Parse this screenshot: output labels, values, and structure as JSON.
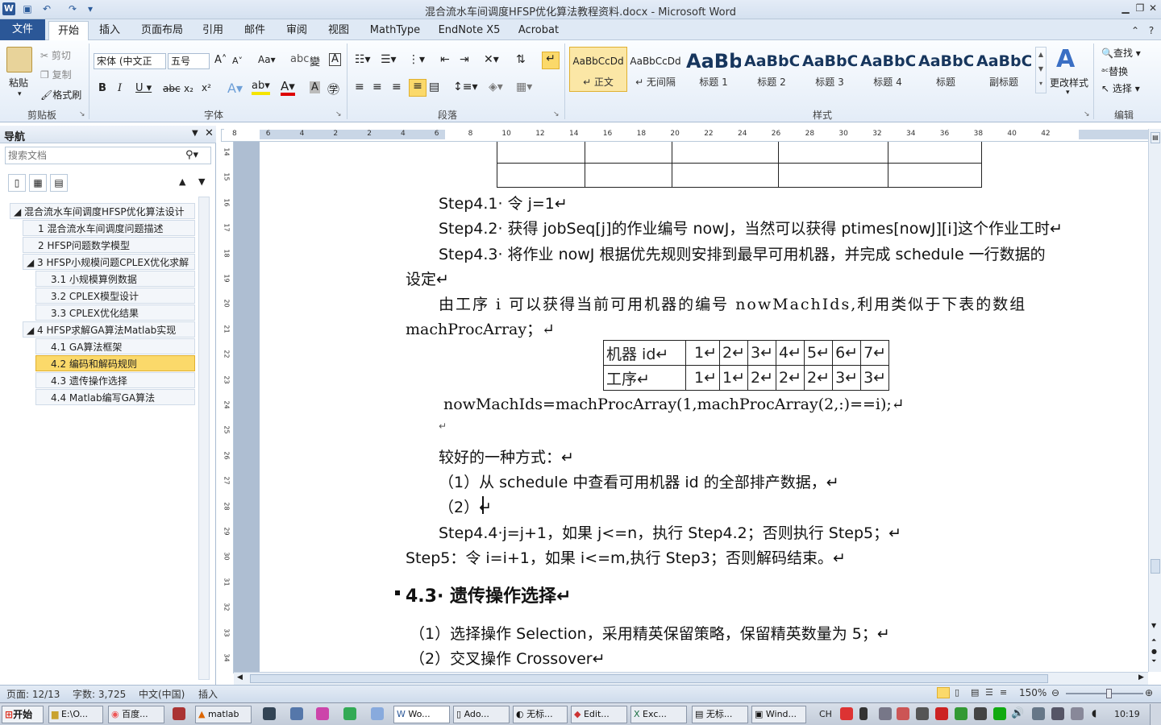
{
  "window": {
    "title": "混合流水车间调度HFSP优化算法教程资料.docx - Microsoft Word"
  },
  "tabs": [
    "文件",
    "开始",
    "插入",
    "页面布局",
    "引用",
    "邮件",
    "审阅",
    "视图",
    "MathType",
    "EndNote X5",
    "Acrobat"
  ],
  "clipboard": {
    "paste": "粘贴",
    "cut": "剪切",
    "copy": "复制",
    "format_painter": "格式刷",
    "group": "剪贴板"
  },
  "font": {
    "name": "宋体 (中文正",
    "size": "五号",
    "group": "字体"
  },
  "paragraph": {
    "group": "段落"
  },
  "styles": {
    "items": [
      {
        "preview": "AaBbCcDd",
        "name": "↵ 正文"
      },
      {
        "preview": "AaBbCcDd",
        "name": "↵ 无间隔"
      },
      {
        "preview": "AaBb",
        "name": "标题 1"
      },
      {
        "preview": "AaBbC",
        "name": "标题 2"
      },
      {
        "preview": "AaBbC",
        "name": "标题 3"
      },
      {
        "preview": "AaBbC",
        "name": "标题 4"
      },
      {
        "preview": "AaBbC",
        "name": "标题"
      },
      {
        "preview": "AaBbC",
        "name": "副标题"
      }
    ],
    "change": "更改样式",
    "group": "样式"
  },
  "editing": {
    "find": "查找",
    "replace": "替换",
    "select": "选择",
    "group": "编辑"
  },
  "nav": {
    "title": "导航",
    "search_placeholder": "搜索文档",
    "items": [
      "混合流水车间调度HFSP优化算法设计",
      "1 混合流水车间调度问题描述",
      "2 HFSP问题数学模型",
      "3 HFSP小规模问题CPLEX优化求解",
      "3.1 小规模算例数据",
      "3.2 CPLEX模型设计",
      "3.3 CPLEX优化结果",
      "4 HFSP求解GA算法Matlab实现",
      "4.1 GA算法框架",
      "4.2 编码和解码规则",
      "4.3 遗传操作选择",
      "4.4 Matlab编写GA算法"
    ]
  },
  "ruler_top": [
    "8",
    "6",
    "4",
    "2",
    "2",
    "4",
    "6",
    "8",
    "10",
    "12",
    "14",
    "16",
    "18",
    "20",
    "22",
    "24",
    "26",
    "28",
    "30",
    "32",
    "34",
    "36",
    "38",
    "40",
    "42"
  ],
  "ruler_left": [
    "14",
    "15",
    "16",
    "17",
    "18",
    "19",
    "20",
    "21",
    "22",
    "23",
    "24",
    "25",
    "26",
    "27",
    "28",
    "29",
    "30",
    "31",
    "32",
    "33",
    "34"
  ],
  "doc": {
    "lines": [
      "Step4.1· 令 j=1↵",
      "Step4.2· 获得 jobSeq[j]的作业编号 nowJ，当然可以获得 ptimes[nowJ][i]这个作业工时↵",
      "Step4.3· 将作业 nowJ 根据优先规则安排到最早可用机器，并完成 schedule 一行数据的",
      "设定↵",
      "由工序 i 可以获得当前可用机器的编号 nowMachIds,利用类似于下表的数组",
      "machProcArray；↵",
      "nowMachIds=machProcArray(1,machProcArray(2,:)==i);↵",
      "↵",
      "较好的一种方式：↵",
      "（1）从 schedule 中查看可用机器 id 的全部排产数据，↵",
      "（2）↵",
      "Step4.4·j=j+1，如果 j<=n，执行 Step4.2；否则执行 Step5；↵",
      "Step5：令 i=i+1，如果 i<=m,执行 Step3；否则解码结束。↵",
      "4.3· 遗传操作选择↵",
      "（1）选择操作 Selection，采用精英保留策略，保留精英数量为 5；↵",
      "（2）交叉操作 Crossover↵"
    ],
    "mach_table": {
      "rows": [
        [
          "机器 id↵",
          "1↵",
          "2↵",
          "3↵",
          "4↵",
          "5↵",
          "6↵",
          "7↵"
        ],
        [
          "工序↵",
          "1↵",
          "1↵",
          "2↵",
          "2↵",
          "2↵",
          "3↵",
          "3↵"
        ]
      ]
    }
  },
  "status": {
    "page": "页面: 12/13",
    "words": "字数: 3,725",
    "lang": "中文(中国)",
    "mode": "插入",
    "zoom": "150%"
  },
  "taskbar": {
    "start": "开始",
    "items": [
      "E:\\O...",
      "百度...",
      "matlab",
      "Wo...",
      "Ado...",
      "无标...",
      "Edit...",
      "Exc...",
      "无标...",
      "Wind..."
    ],
    "ime": "CH",
    "clock": "10:19"
  }
}
